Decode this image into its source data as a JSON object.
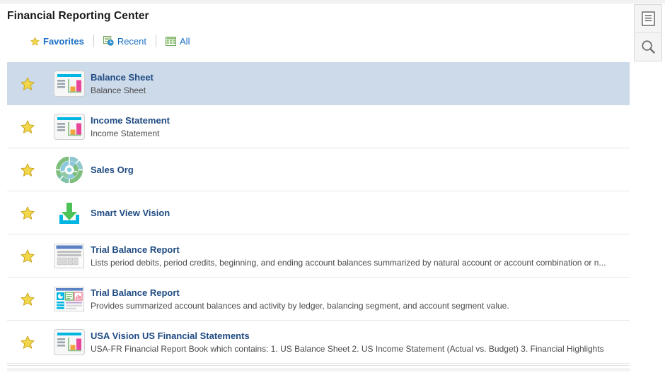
{
  "header": {
    "title": "Financial Reporting Center"
  },
  "tabs": [
    {
      "label": "Favorites",
      "icon": "star-icon",
      "active": true
    },
    {
      "label": "Recent",
      "icon": "recent-clock-icon",
      "active": false
    },
    {
      "label": "All",
      "icon": "grid-table-icon",
      "active": false
    }
  ],
  "list": {
    "items": [
      {
        "title": "Balance Sheet",
        "description": "Balance Sheet",
        "icon": "report-bar-chart-icon",
        "favorite_icon": "star-icon",
        "selected": true
      },
      {
        "title": "Income Statement",
        "description": "Income Statement",
        "icon": "report-bar-chart-icon",
        "favorite_icon": "star-icon",
        "selected": false
      },
      {
        "title": "Sales Org",
        "description": "",
        "icon": "sunburst-donut-chart-icon",
        "favorite_icon": "star-icon",
        "selected": false
      },
      {
        "title": "Smart View Vision",
        "description": "",
        "icon": "download-arrow-icon",
        "favorite_icon": "star-icon",
        "selected": false
      },
      {
        "title": "Trial Balance Report",
        "description": "Lists period debits, period credits, beginning, and ending account balances summarized by natural account or account combination or n...",
        "icon": "spreadsheet-table-icon",
        "favorite_icon": "star-icon",
        "selected": false
      },
      {
        "title": "Trial Balance Report",
        "description": "Provides summarized account balances and activity by ledger, balancing segment, and account segment value.",
        "icon": "dashboard-panels-icon",
        "favorite_icon": "star-icon",
        "selected": false
      },
      {
        "title": "USA Vision US Financial Statements",
        "description": "USA-FR Financial Report Book which contains: 1. US Balance Sheet 2. US Income Statement (Actual vs. Budget) 3. Financial Highlights",
        "icon": "report-bar-chart-icon",
        "favorite_icon": "star-icon",
        "selected": false
      }
    ]
  },
  "side_rail": {
    "buttons": [
      {
        "name": "document-list-icon",
        "tooltip": ""
      },
      {
        "name": "search-icon",
        "tooltip": ""
      }
    ]
  },
  "colors": {
    "link": "#1a6fc4",
    "title_link": "#1f4b82",
    "selected_row": "#cddaea",
    "star_fill": "#f2d64b",
    "star_stroke": "#c9a81f"
  }
}
